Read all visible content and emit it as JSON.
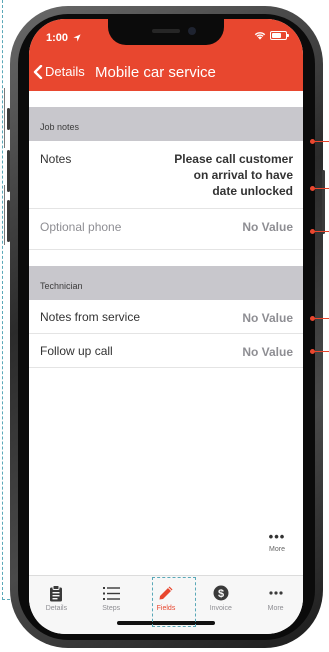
{
  "status_bar": {
    "time": "1:00"
  },
  "header": {
    "back_label": "Details",
    "title": "Mobile car service"
  },
  "sections": {
    "job_notes": {
      "title": "Job notes",
      "notes_label": "Notes",
      "notes_value_lines": [
        "Please call customer",
        "on arrival to have",
        "date unlocked"
      ],
      "phone_label": "Optional phone",
      "phone_value": "No Value"
    },
    "technician": {
      "title": "Technician",
      "notes_label": "Notes from service",
      "notes_value": "No Value",
      "followup_label": "Follow up call",
      "followup_value": "No Value"
    }
  },
  "more_floating": {
    "dots": "•••",
    "label": "More"
  },
  "tabs": [
    {
      "label": "Details",
      "icon": "clipboard-icon"
    },
    {
      "label": "Steps",
      "icon": "list-icon"
    },
    {
      "label": "Fields",
      "icon": "pencil-icon",
      "active": true
    },
    {
      "label": "Invoice",
      "icon": "dollar-circle-icon"
    },
    {
      "label": "More",
      "icon": "ellipsis-icon"
    }
  ],
  "colors": {
    "accent": "#e8472f",
    "annotation": "#5aa8b8"
  }
}
